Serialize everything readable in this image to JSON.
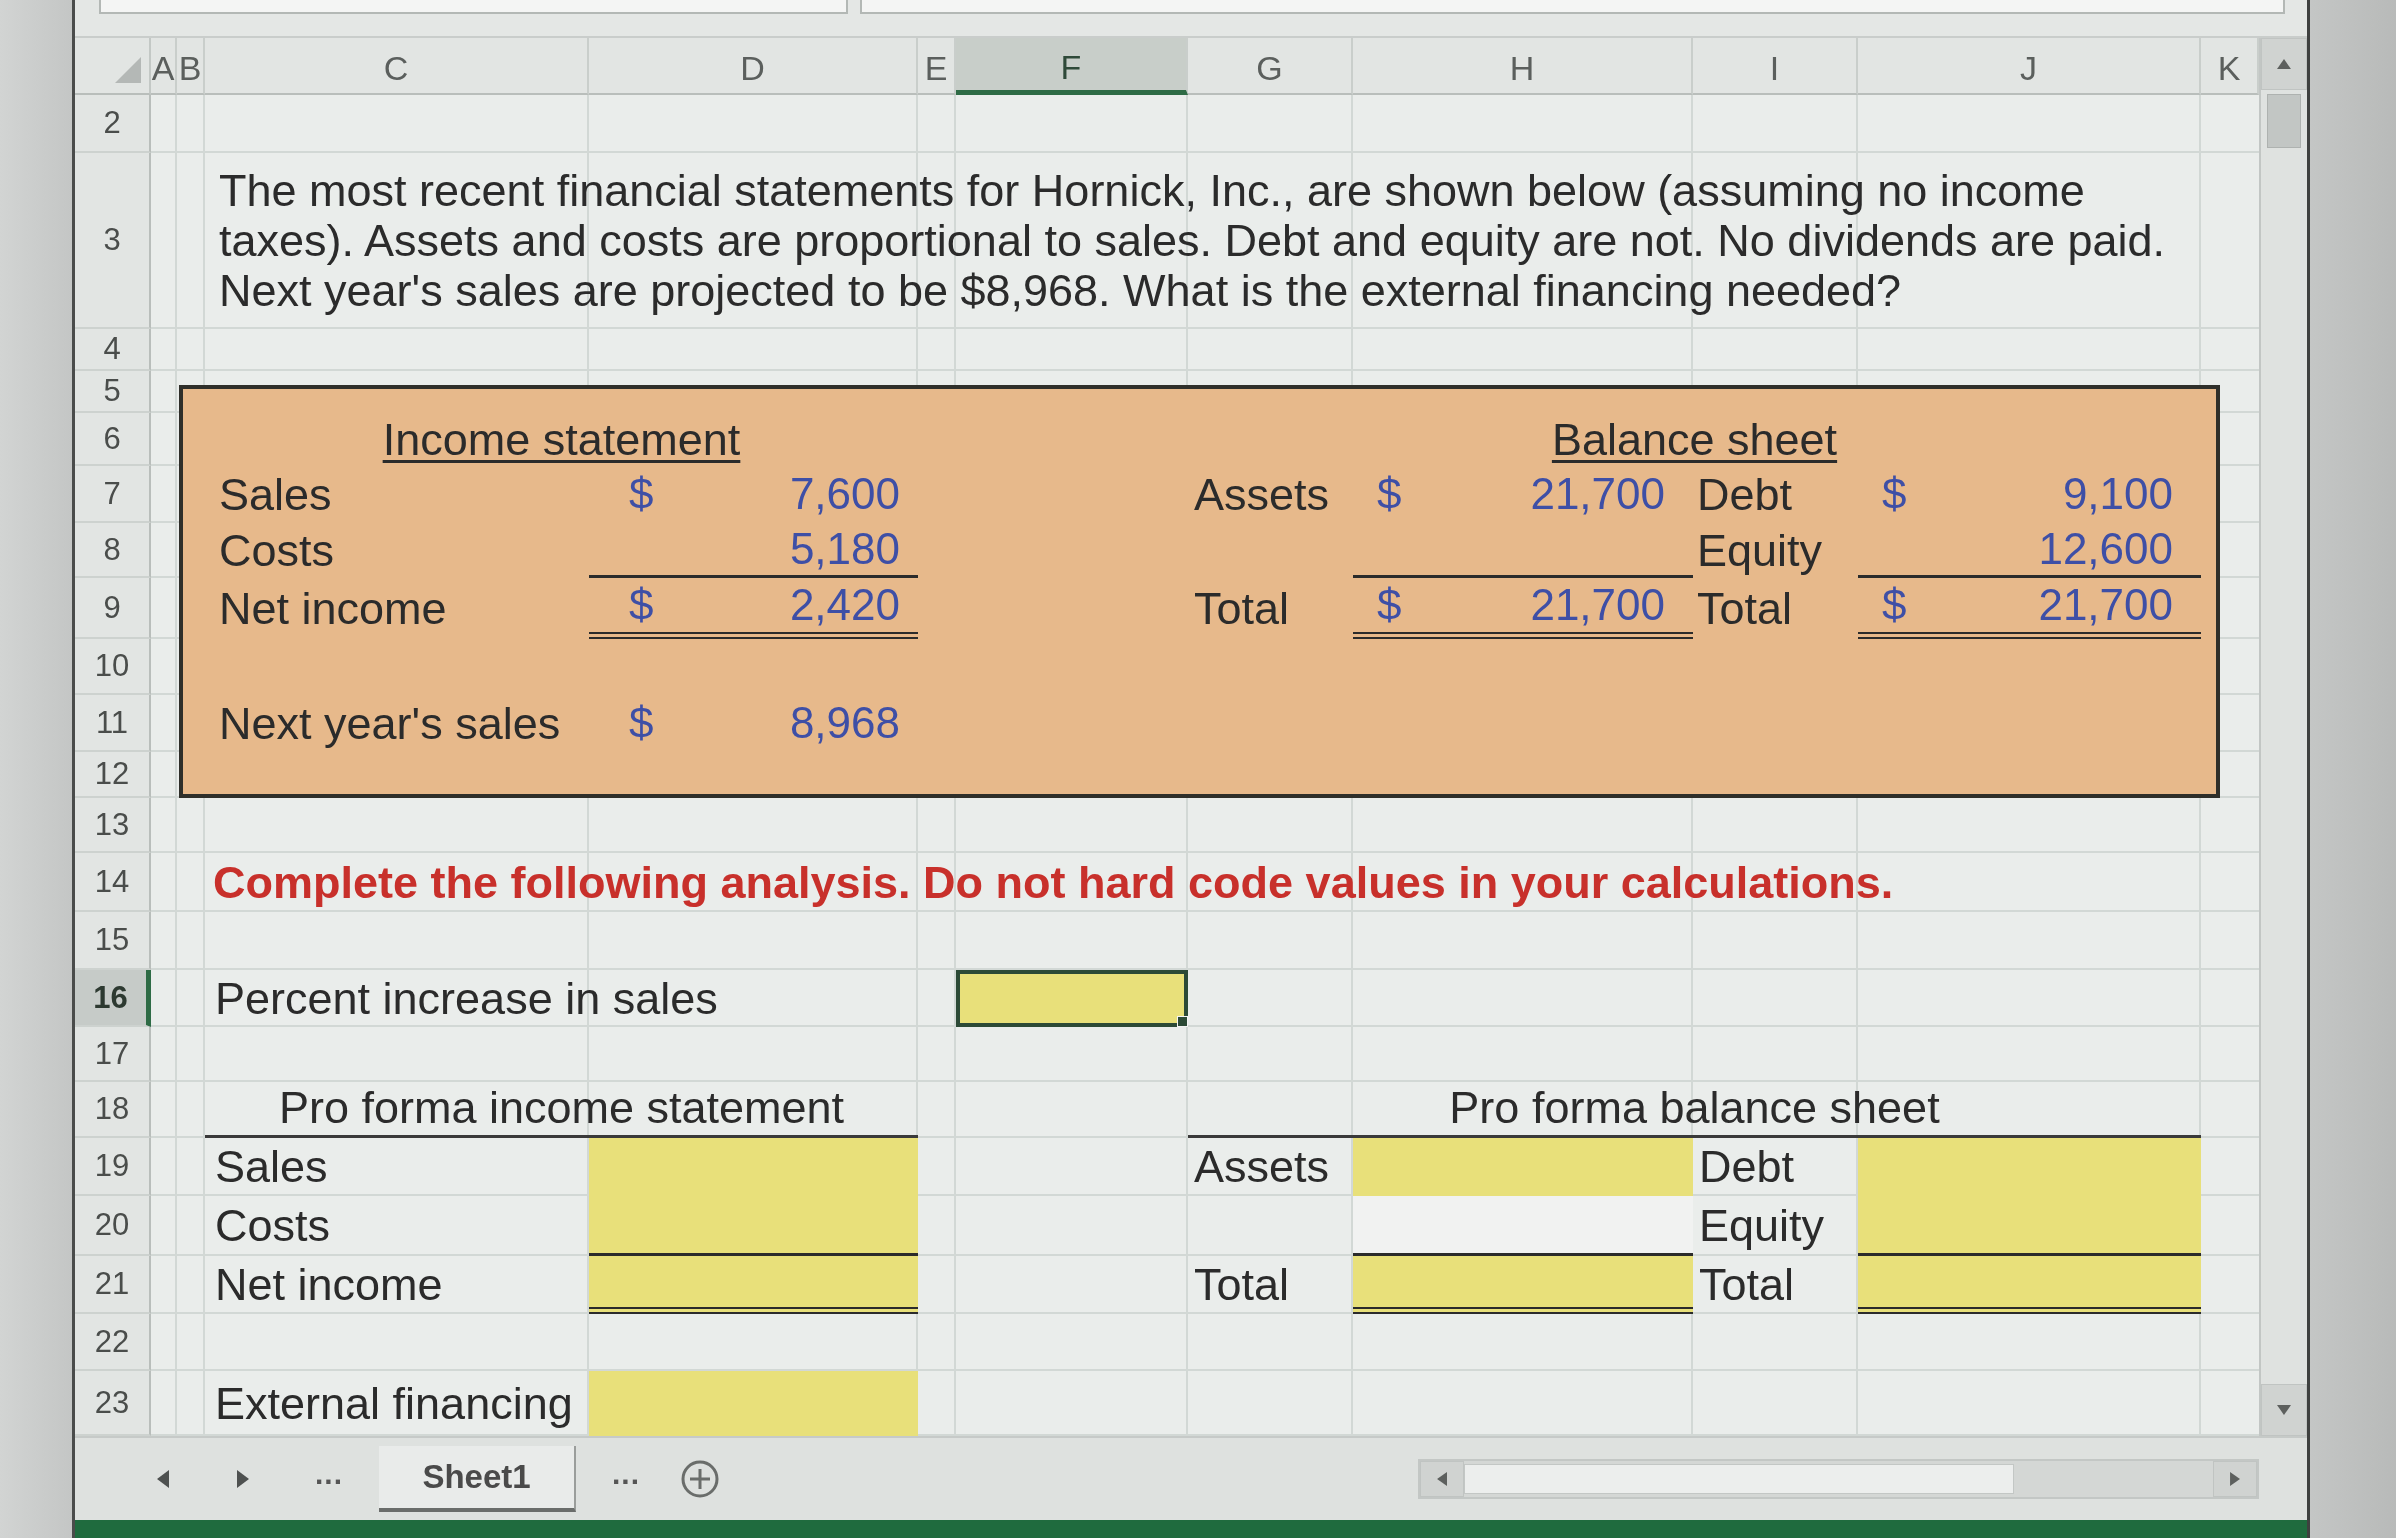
{
  "column_headers": [
    {
      "label": "A",
      "selected": false
    },
    {
      "label": "B",
      "selected": false
    },
    {
      "label": "C",
      "selected": false
    },
    {
      "label": "D",
      "selected": false
    },
    {
      "label": "E",
      "selected": false
    },
    {
      "label": "F",
      "selected": true
    },
    {
      "label": "G",
      "selected": false
    },
    {
      "label": "H",
      "selected": false
    },
    {
      "label": "I",
      "selected": false
    },
    {
      "label": "J",
      "selected": false
    },
    {
      "label": "K",
      "selected": false
    }
  ],
  "row_headers": [
    {
      "label": "2",
      "selected": false
    },
    {
      "label": "3",
      "selected": false
    },
    {
      "label": "4",
      "selected": false
    },
    {
      "label": "5",
      "selected": false
    },
    {
      "label": "6",
      "selected": false
    },
    {
      "label": "7",
      "selected": false
    },
    {
      "label": "8",
      "selected": false
    },
    {
      "label": "9",
      "selected": false
    },
    {
      "label": "10",
      "selected": false
    },
    {
      "label": "11",
      "selected": false
    },
    {
      "label": "12",
      "selected": false
    },
    {
      "label": "13",
      "selected": false
    },
    {
      "label": "14",
      "selected": false
    },
    {
      "label": "15",
      "selected": false
    },
    {
      "label": "16",
      "selected": true
    },
    {
      "label": "17",
      "selected": false
    },
    {
      "label": "18",
      "selected": false
    },
    {
      "label": "19",
      "selected": false
    },
    {
      "label": "20",
      "selected": false
    },
    {
      "label": "21",
      "selected": false
    },
    {
      "label": "22",
      "selected": false
    },
    {
      "label": "23",
      "selected": false
    }
  ],
  "problem_text": "The most recent financial statements for Hornick, Inc., are shown below (assuming no income taxes). Assets and costs are proportional to sales. Debt and equity are not. No dividends are paid. Next year's sales are projected to be $8,968. What is the external financing needed?",
  "income_statement": {
    "title": "Income statement",
    "rows": [
      {
        "kind": "plain",
        "label": "Sales",
        "currency": "$",
        "value": "7,600"
      },
      {
        "kind": "ruled",
        "label": "Costs",
        "value": "5,180"
      },
      {
        "kind": "total",
        "label": "Net income",
        "currency": "$",
        "value": "2,420"
      }
    ]
  },
  "balance_sheet": {
    "title": "Balance sheet",
    "left_rows": [
      {
        "kind": "plain",
        "label": "Assets",
        "currency": "$",
        "value": "21,700"
      },
      {
        "kind": "ruled"
      },
      {
        "kind": "total",
        "label": "Total",
        "currency": "$",
        "value": "21,700"
      }
    ],
    "right_rows": [
      {
        "kind": "plain",
        "label": "Debt",
        "currency": "$",
        "value": "9,100"
      },
      {
        "kind": "ruled",
        "label": "Equity",
        "value": "12,600"
      },
      {
        "kind": "total",
        "label": "Total",
        "currency": "$",
        "value": "21,700"
      }
    ]
  },
  "next_year_sales": {
    "label": "Next year's sales",
    "currency": "$",
    "value": "8,968"
  },
  "instruction": "Complete the following analysis. Do not hard code values in your calculations.",
  "percent_increase": {
    "label": "Percent increase in sales",
    "selected": true
  },
  "pro_forma_income": {
    "title": "Pro forma income statement",
    "rows": [
      {
        "kind": "plain",
        "label": "Sales",
        "input": true
      },
      {
        "kind": "ruled",
        "label": "Costs",
        "input": true
      },
      {
        "kind": "total",
        "label": "Net income",
        "input": true
      }
    ]
  },
  "external_financing": {
    "label": "External financing",
    "input": true
  },
  "pro_forma_balance": {
    "title": "Pro forma balance sheet",
    "left_rows": [
      {
        "kind": "plain",
        "label": "Assets",
        "input": true
      },
      {
        "kind": "ruled",
        "input": false
      },
      {
        "kind": "total",
        "label": "Total",
        "input": true
      }
    ],
    "right_rows": [
      {
        "kind": "plain",
        "label": "Debt",
        "input": true
      },
      {
        "kind": "ruled",
        "label": "Equity",
        "input": true
      },
      {
        "kind": "total",
        "label": "Total",
        "input": true
      }
    ]
  },
  "sheet_tabs": {
    "more_left": "...",
    "tabs": [
      {
        "label": "Sheet1",
        "selected": true
      }
    ],
    "more_right": "..."
  }
}
